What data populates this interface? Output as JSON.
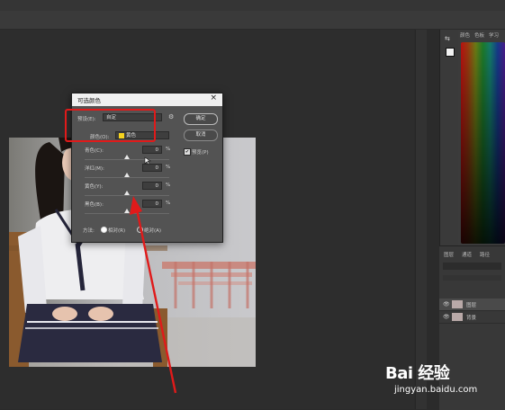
{
  "dialog": {
    "title": "可选颜色",
    "close": "×",
    "preset_label": "预设(E):",
    "preset_value": "自定",
    "colors_label": "颜色(O):",
    "colors_value": "黄色",
    "ok_label": "确定",
    "cancel_label": "取消",
    "preview_label": "预览(P)",
    "sliders": [
      {
        "label": "青色(C):",
        "value": "0",
        "unit": "%"
      },
      {
        "label": "洋红(M):",
        "value": "0",
        "unit": "%"
      },
      {
        "label": "黄色(Y):",
        "value": "0",
        "unit": "%"
      },
      {
        "label": "黑色(B):",
        "value": "0",
        "unit": "%"
      }
    ],
    "method_label": "方法:",
    "method_relative": "相对(R)",
    "method_absolute": "绝对(A)"
  },
  "panels": {
    "color_tabs": [
      "颜色",
      "色板",
      "学习"
    ],
    "layers_tabs": [
      "图层",
      "通道",
      "路径"
    ],
    "layers": [
      {
        "name": "图层"
      },
      {
        "name": "背景"
      }
    ]
  },
  "watermark": {
    "logo": "Bai 经验",
    "url": "jingyan.baidu.com"
  },
  "colors": {
    "accent_red": "#e01a1a",
    "swatch_yellow": "#f5d21e"
  }
}
